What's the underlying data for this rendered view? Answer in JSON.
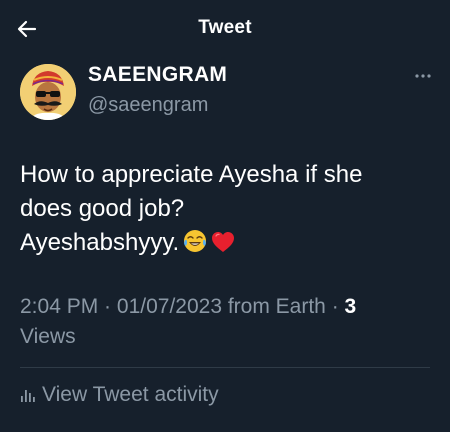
{
  "header": {
    "title": "Tweet",
    "back_icon": "arrow-left-icon"
  },
  "author": {
    "name": "SAEENGRAM",
    "handle": "@saeengram",
    "avatar_icon": "cartoon-avatar"
  },
  "more_icon": "more-horizontal-icon",
  "tweet": {
    "line1": "How to appreciate Ayesha if she",
    "line2": "does good job?",
    "line3": "Ayeshabshyyy.",
    "emojis": [
      "face-with-tears-of-joy-emoji",
      "red-heart-emoji"
    ]
  },
  "meta": {
    "time": "2:04 PM",
    "separator1": " · ",
    "date": "01/07/2023",
    "source": " from Earth",
    "separator2": " · ",
    "views_count": "3",
    "views_label": "Views"
  },
  "activity": {
    "label": "View Tweet activity",
    "icon": "bar-chart-icon"
  },
  "colors": {
    "background": "#16202c",
    "text_primary": "#ffffff",
    "text_secondary": "#8b98a5",
    "divider": "#2f3b47"
  }
}
